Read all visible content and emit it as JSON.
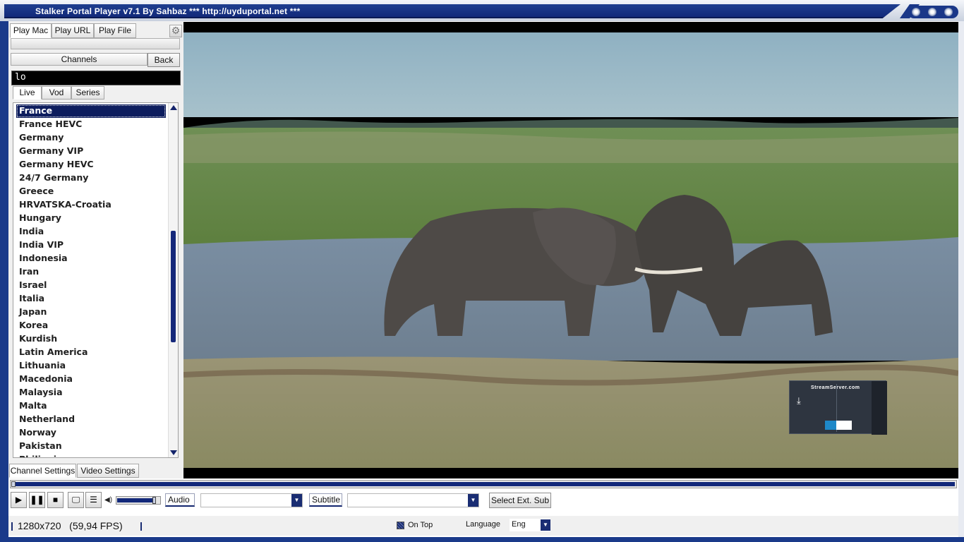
{
  "window": {
    "title": "Stalker Portal Player v7.1 By Sahbaz   *** http://uyduportal.net ***"
  },
  "left_panel": {
    "top_tabs": [
      "Play Mac",
      "Play URL",
      "Play File"
    ],
    "channels_label": "Channels",
    "back_label": "Back",
    "search_value": "lo",
    "type_tabs": [
      "Live",
      "Vod",
      "Series"
    ],
    "selected_index": 0,
    "channels": [
      "France",
      "France HEVC",
      "Germany",
      "Germany VIP",
      "Germany HEVC",
      "24/7 Germany",
      "Greece",
      "HRVATSKA-Croatia",
      "Hungary",
      "India",
      "India VIP",
      "Indonesia",
      "Iran",
      "Israel",
      "Italia",
      "Japan",
      "Korea",
      "Kurdish",
      "Latin America",
      "Lithuania",
      "Macedonia",
      "Malaysia",
      "Malta",
      "Netherland",
      "Norway",
      "Pakistan",
      "Philippines"
    ],
    "bottom_tabs": [
      "Channel Settings",
      "Video Settings"
    ]
  },
  "video": {
    "watermark_title": "StreamServer.com"
  },
  "controls": {
    "seek_fraction": 0.0,
    "volume_fraction": 0.92,
    "audio_label": "Audio",
    "audio_value": "",
    "subtitle_label": "Subtitle",
    "subtitle_value": "",
    "select_ext_sub": "Select Ext. Sub"
  },
  "status": {
    "resolution": "1280x720   (59,94 FPS)",
    "on_top_label": "On Top",
    "on_top_checked": true,
    "language_label": "Language",
    "language_value": "Eng"
  },
  "colors": {
    "accent": "#12287a",
    "selection": "#0d1d5e"
  },
  "icons": {
    "play": "play-icon",
    "pause": "pause-icon",
    "stop": "stop-icon",
    "screen": "monitor-icon",
    "playlist": "list-icon",
    "volume": "speaker-icon",
    "settings": "gear-icon"
  }
}
